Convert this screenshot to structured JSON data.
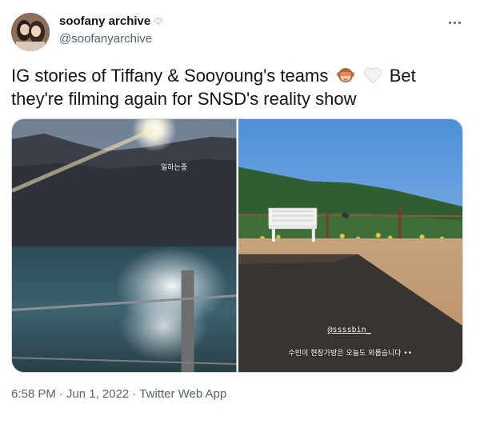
{
  "author": {
    "display_name": "soofany archive",
    "badge_icon": "heart-outline-icon",
    "badge_glyph": "♡",
    "handle": "@soofanyarchive"
  },
  "more_menu_icon": "more-horizontal-icon",
  "tweet": {
    "text_part1": "IG stories of Tiffany & Sooyoung's teams",
    "emoji1": "see-no-evil-monkey-emoji",
    "emoji2": "white-heart-emoji",
    "text_part2": " Bet they're filming again for SNSD's reality show"
  },
  "media": {
    "left": {
      "scene": "sunset-lake-with-mountains",
      "caption": "일하는중"
    },
    "right": {
      "scene": "field-with-white-bench-and-mountains",
      "mention": "@ssssbin_",
      "caption": "수빈이 현장가방은 오늘도 외롭습니다 ••"
    }
  },
  "meta": {
    "time": "6:58 PM",
    "sep1": "·",
    "date": "Jun 1, 2022",
    "sep2": "·",
    "source": "Twitter Web App"
  },
  "colors": {
    "text": "#0f1419",
    "secondary": "#536471",
    "border": "#cfd9de"
  }
}
